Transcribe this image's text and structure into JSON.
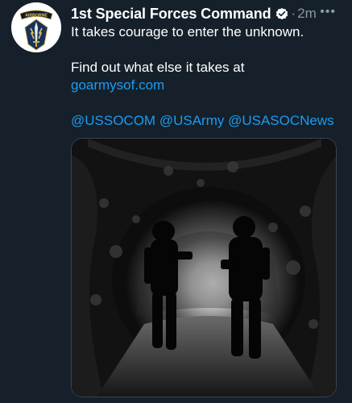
{
  "tweet": {
    "author_name": "1st Special Forces Command",
    "separator": "·",
    "timestamp": "2m",
    "more_label": "•••",
    "text_line1": "It takes courage to enter the unknown.",
    "text_line2": "Find out what else it takes at",
    "link_text": "goarmysof.com",
    "mentions": "@USSOCOM @USArmy @USASOCNews"
  },
  "avatar": {
    "tab_text": "AIRBORNE"
  },
  "colors": {
    "background": "#15202b",
    "link": "#1d9bf0",
    "secondary_text": "#8b98a5",
    "verified": "#ffffff"
  }
}
